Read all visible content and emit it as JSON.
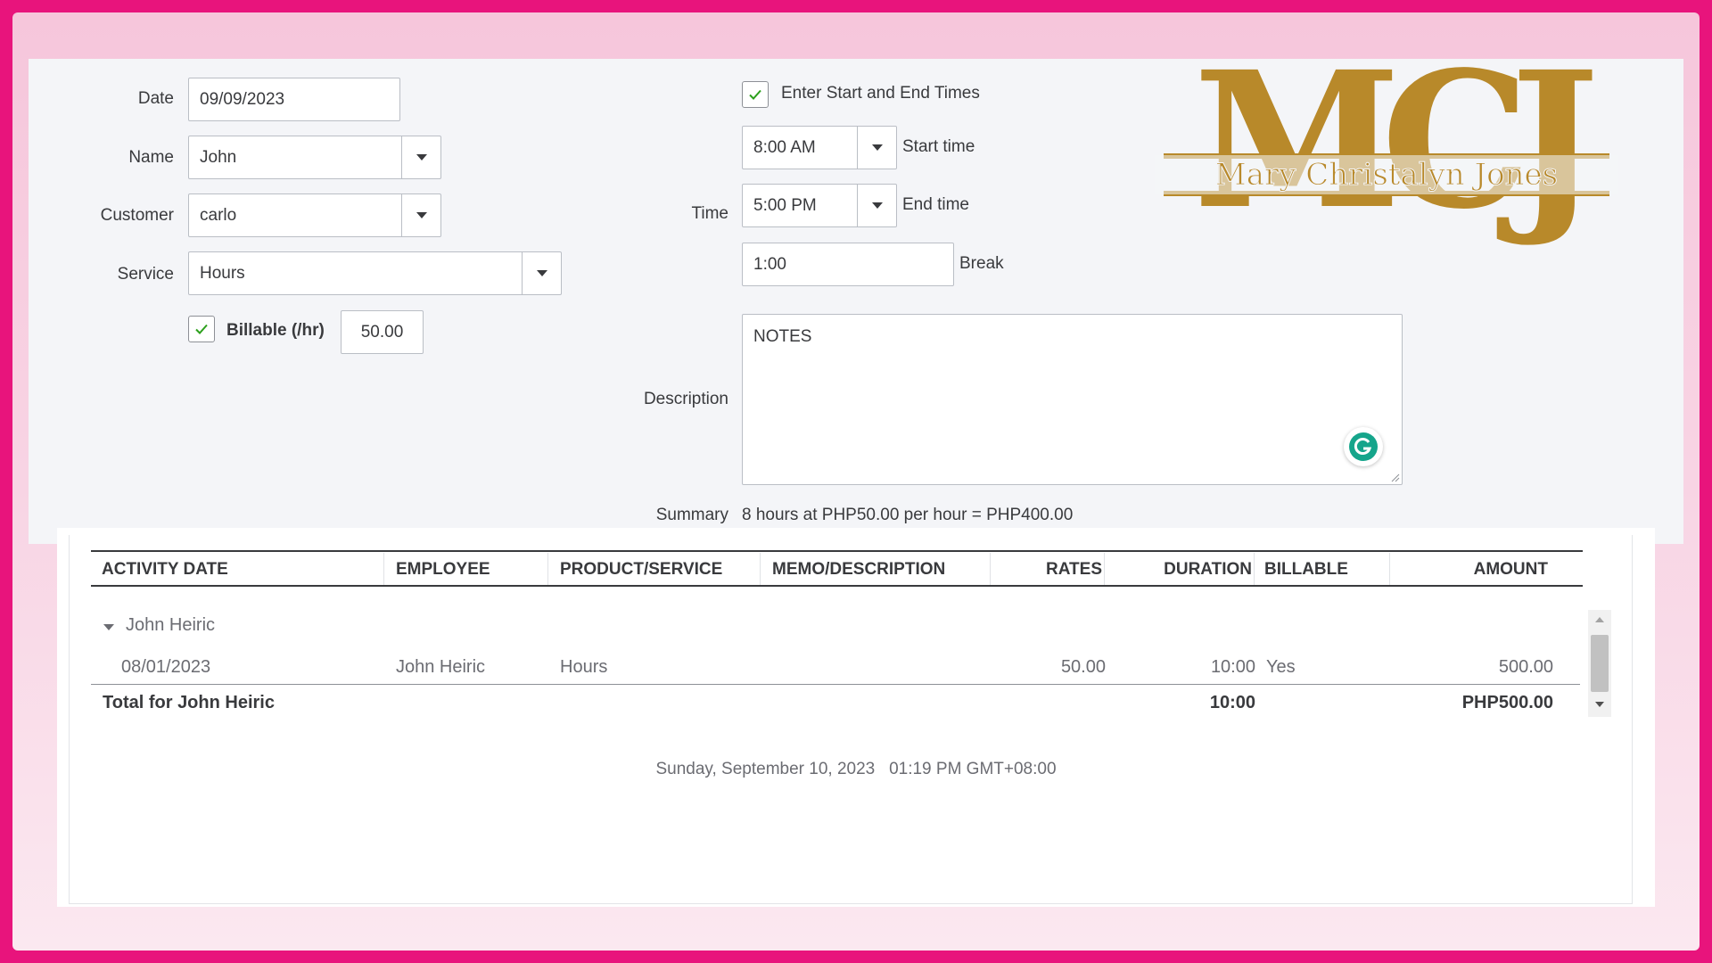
{
  "form": {
    "date_label": "Date",
    "date_value": "09/09/2023",
    "name_label": "Name",
    "name_value": "John",
    "customer_label": "Customer",
    "customer_value": "carlo",
    "service_label": "Service",
    "service_value": "Hours",
    "billable_label": "Billable (/hr)",
    "billable_checked": true,
    "rate_value": "50.00",
    "enter_times_label": "Enter Start and End Times",
    "enter_times_checked": true,
    "time_label": "Time",
    "start_time_value": "8:00 AM",
    "start_time_label": "Start time",
    "end_time_value": "5:00 PM",
    "end_time_label": "End time",
    "break_value": "1:00",
    "break_label": "Break",
    "description_label": "Description",
    "description_value": "NOTES",
    "summary_label": "Summary",
    "summary_value": "8 hours at PHP50.00 per hour = PHP400.00"
  },
  "logo": {
    "monogram": "MCJ",
    "name": "Mary Christalyn Jones",
    "color": "#b8892a"
  },
  "report": {
    "columns": [
      "ACTIVITY DATE",
      "EMPLOYEE",
      "PRODUCT/SERVICE",
      "MEMO/DESCRIPTION",
      "RATES",
      "DURATION",
      "BILLABLE",
      "AMOUNT"
    ],
    "group_name": "John Heiric",
    "row": {
      "activity_date": "08/01/2023",
      "employee": "John Heiric",
      "product_service": "Hours",
      "memo": "",
      "rates": "50.00",
      "duration": "10:00",
      "billable": "Yes",
      "amount": "500.00"
    },
    "total_label": "Total for John Heiric",
    "total_duration": "10:00",
    "total_amount": "PHP500.00",
    "timestamp": "Sunday, September 10, 2023   01:19 PM GMT+08:00"
  },
  "colors": {
    "frame": "#e8147c",
    "check_green": "#2ca01c",
    "grammarly": "#15a58b"
  }
}
